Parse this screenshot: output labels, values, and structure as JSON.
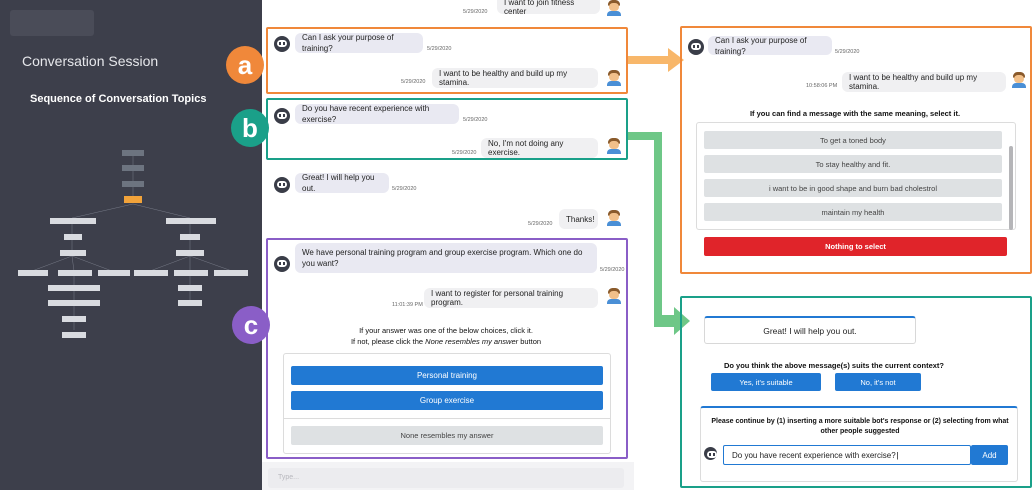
{
  "sidebar": {
    "session_title": "Conversation Session",
    "topics_title": "Sequence of Conversation Topics"
  },
  "chat": {
    "top_user_message": "I want to join fitness center",
    "top_user_time": "5/29/2020",
    "a_bot_message": "Can I ask your purpose of training?",
    "a_bot_time": "5/29/2020",
    "a_user_message": "I want to be healthy and build up my stamina.",
    "a_user_time": "5/29/2020",
    "b_bot_message": "Do you have recent experience with exercise?",
    "b_bot_time": "5/29/2020",
    "b_user_message": "No, I'm not doing any exercise.",
    "b_user_time": "5/29/2020",
    "great_bot_message": "Great! I will help you out.",
    "great_bot_time": "5/29/2020",
    "thanks_user_message": "Thanks!",
    "thanks_user_time": "5/29/2020",
    "c_bot_message": "We have personal training program and group exercise program. Which one do you want?",
    "c_bot_time": "5/29/2020",
    "c_user_message": "I want to register for personal training program.",
    "c_user_time": "11:01:39 PM",
    "c_prompt_line1": "If your answer was one of the below choices, click it.",
    "c_prompt_line2_prefix": "If not, please click the ",
    "c_prompt_line2_italic": "None resembles my answer",
    "c_prompt_line2_suffix": " button",
    "c_options": [
      "Personal training",
      "Group exercise"
    ],
    "c_none_button": "None resembles my answer",
    "type_placeholder": "Type..."
  },
  "labels": {
    "a": "a",
    "b": "b",
    "c": "c"
  },
  "panel_a": {
    "bot_message": "Can I ask your purpose of training?",
    "bot_time": "5/29/2020",
    "user_message": "I want to be healthy and build up my stamina.",
    "user_time": "10:58:06 PM",
    "prompt": "If you can find a message with the same meaning, select it.",
    "options": [
      "To get a toned body",
      "To stay healthy and fit.",
      "i want to be in good shape and burn bad cholestrol",
      "maintain my health"
    ],
    "nothing_button": "Nothing to select"
  },
  "panel_b": {
    "bot_message": "Great! I will help you out.",
    "question": "Do you think the above message(s) suits the current context?",
    "yes_button": "Yes, it's suitable",
    "no_button": "No, it's not",
    "instruction": "Please continue by (1) inserting a more suitable bot's response or (2) selecting from what other people suggested",
    "input_value": "Do you have recent experience with exercise?",
    "add_button": "Add"
  },
  "colors": {
    "a": "#f0883a",
    "b": "#1aa089",
    "c": "#8a5ec7",
    "sidebar_bg": "#3d3f4b",
    "primary_blue": "#2179d3",
    "danger_red": "#e0242a"
  }
}
